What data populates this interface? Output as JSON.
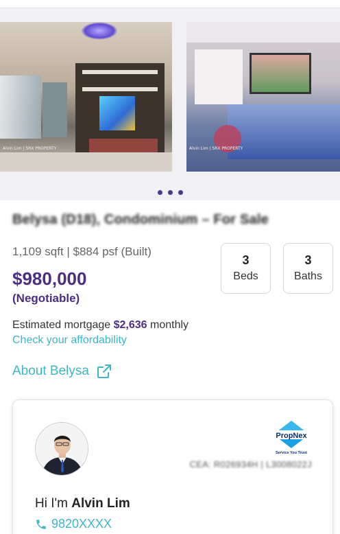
{
  "gallery": {
    "photos": [
      {
        "watermark": "Alvin Lim | SRX PROPERTY"
      },
      {
        "watermark": "Alvin Lim | SRX PROPERTY"
      }
    ],
    "dot_count": 3,
    "dot_color": "#4a3a8a"
  },
  "listing": {
    "title": "Belysa (D18), Condominium – For Sale",
    "size_info": "1,109 sqft | $884 psf (Built)",
    "price": "$980,000",
    "negotiable": "(Negotiable)",
    "beds_value": "3",
    "beds_label": "Beds",
    "baths_value": "3",
    "baths_label": "Baths",
    "mortgage_prefix": "Estimated mortgage ",
    "mortgage_amount": "$2,636",
    "mortgage_suffix": " monthly",
    "affordability_link": "Check your affordability",
    "about_link": "About Belysa"
  },
  "agent": {
    "logo_text": "PropNex",
    "logo_tagline": "Service You Trust",
    "cea": "CEA: R026934H | L3008022J",
    "greeting_prefix": "Hi I'm ",
    "name": "Alvin Lim",
    "phone": "9820XXXX"
  },
  "colors": {
    "brand_purple": "#4b2d83",
    "link_teal": "#3fb6c4"
  }
}
